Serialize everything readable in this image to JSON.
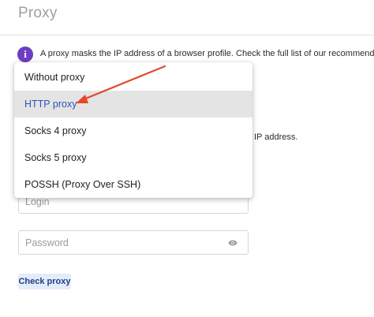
{
  "header": {
    "title": "Proxy"
  },
  "info": {
    "icon": "info-icon",
    "text": "A proxy masks the IP address of a browser profile. Check the full list of our recommended",
    "partial_continuation": "IP address."
  },
  "proxy_type_dropdown": {
    "selected": "HTTP proxy",
    "options": [
      {
        "label": "Without proxy",
        "selected": false
      },
      {
        "label": "HTTP proxy",
        "selected": true
      },
      {
        "label": "Socks 4 proxy",
        "selected": false
      },
      {
        "label": "Socks 5 proxy",
        "selected": false
      },
      {
        "label": "POSSH (Proxy Over SSH)",
        "selected": false
      }
    ]
  },
  "login": {
    "placeholder": "Login",
    "value": ""
  },
  "password": {
    "placeholder": "Password",
    "value": "",
    "icon": "eye-icon"
  },
  "check_button": {
    "label": "Check proxy"
  },
  "colors": {
    "accent": "#2c55b8",
    "info_icon": "#6f3cc4",
    "annotation_arrow": "#e4472b",
    "selected_row_bg": "#e4e4e4",
    "button_bg": "#e4ecfa"
  }
}
